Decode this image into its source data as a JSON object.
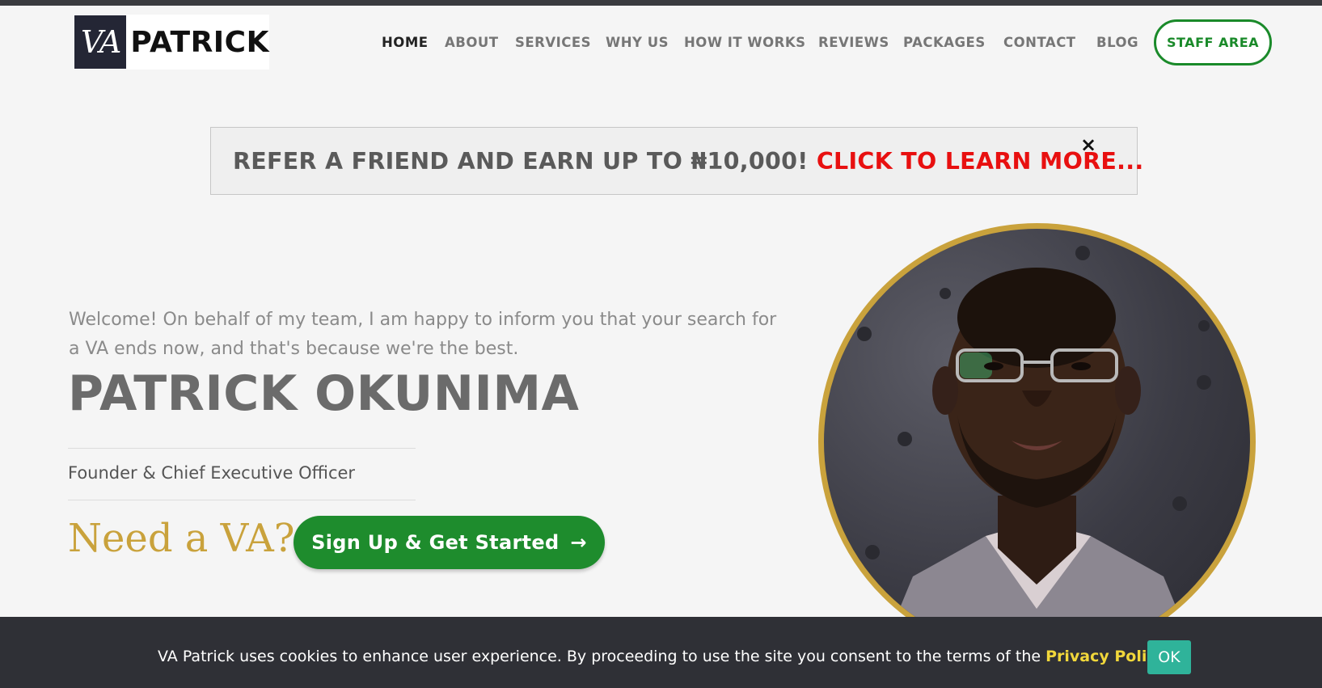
{
  "logo": {
    "mark": "VA",
    "text": "PATRICK"
  },
  "nav": {
    "items": [
      {
        "label": "HOME",
        "active": true
      },
      {
        "label": "ABOUT"
      },
      {
        "label": "SERVICES"
      },
      {
        "label": "WHY US"
      },
      {
        "label": "HOW IT WORKS"
      },
      {
        "label": "REVIEWS"
      },
      {
        "label": "PACKAGES"
      },
      {
        "label": "CONTACT"
      },
      {
        "label": "BLOG"
      }
    ],
    "staff_label": "STAFF AREA"
  },
  "promo": {
    "text": "REFER A FRIEND AND EARN UP TO ₦10,000! ",
    "link": "CLICK TO LEARN MORE...",
    "close": "×"
  },
  "hero": {
    "welcome": "Welcome! On behalf of my team, I am happy to inform you that your search for a VA ends now, and that's because we're the best.",
    "name": "PATRICK OKUNIMA",
    "role": "Founder & Chief Executive Officer",
    "need_va": "Need a VA?",
    "cta_label": "Sign Up & Get Started",
    "cta_icon": "→"
  },
  "cookie": {
    "text": "VA Patrick uses cookies to enhance user experience. By proceeding to use the site you consent to the terms of the ",
    "link": "Privacy Policy",
    "suffix": ".",
    "ok_label": "OK"
  },
  "colors": {
    "accent_green": "#1e8c2d",
    "gold": "#c9a23c",
    "promo_red": "#e81010",
    "cookie_link": "#f1d73b",
    "ok_button": "#2fb39a"
  }
}
